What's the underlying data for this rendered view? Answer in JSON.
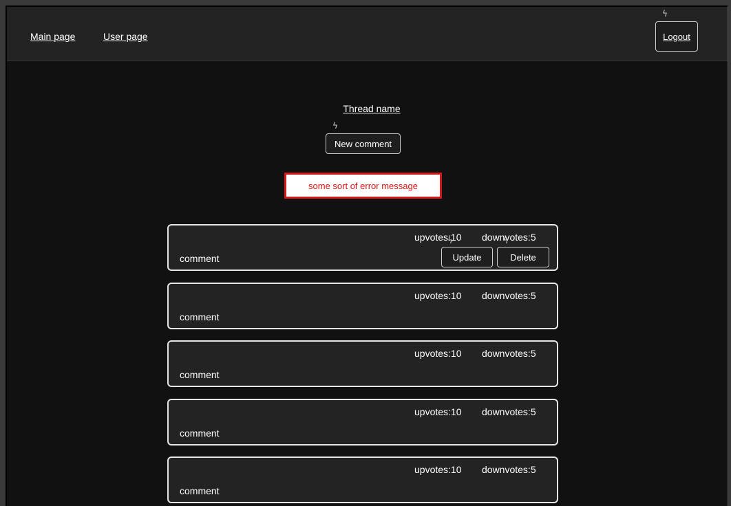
{
  "nav": {
    "main_page": "Main page",
    "user_page": "User page",
    "logout": "Logout"
  },
  "thread": {
    "name": "Thread name",
    "new_comment_label": "New comment"
  },
  "error": {
    "message": "some sort of error message",
    "color": "#e01010"
  },
  "icons": {
    "bolt": "⚡ lightning-bolt-icon"
  },
  "comments": [
    {
      "text": "comment",
      "upvotes": "upvotes:10",
      "downvotes": "downvotes:5",
      "update_label": "Update",
      "delete_label": "Delete"
    },
    {
      "text": "comment",
      "upvotes": "upvotes:10",
      "downvotes": "downvotes:5"
    },
    {
      "text": "comment",
      "upvotes": "upvotes:10",
      "downvotes": "downvotes:5"
    },
    {
      "text": "comment",
      "upvotes": "upvotes:10",
      "downvotes": "downvotes:5"
    },
    {
      "text": "comment",
      "upvotes": "upvotes:10",
      "downvotes": "downvotes:5"
    }
  ]
}
